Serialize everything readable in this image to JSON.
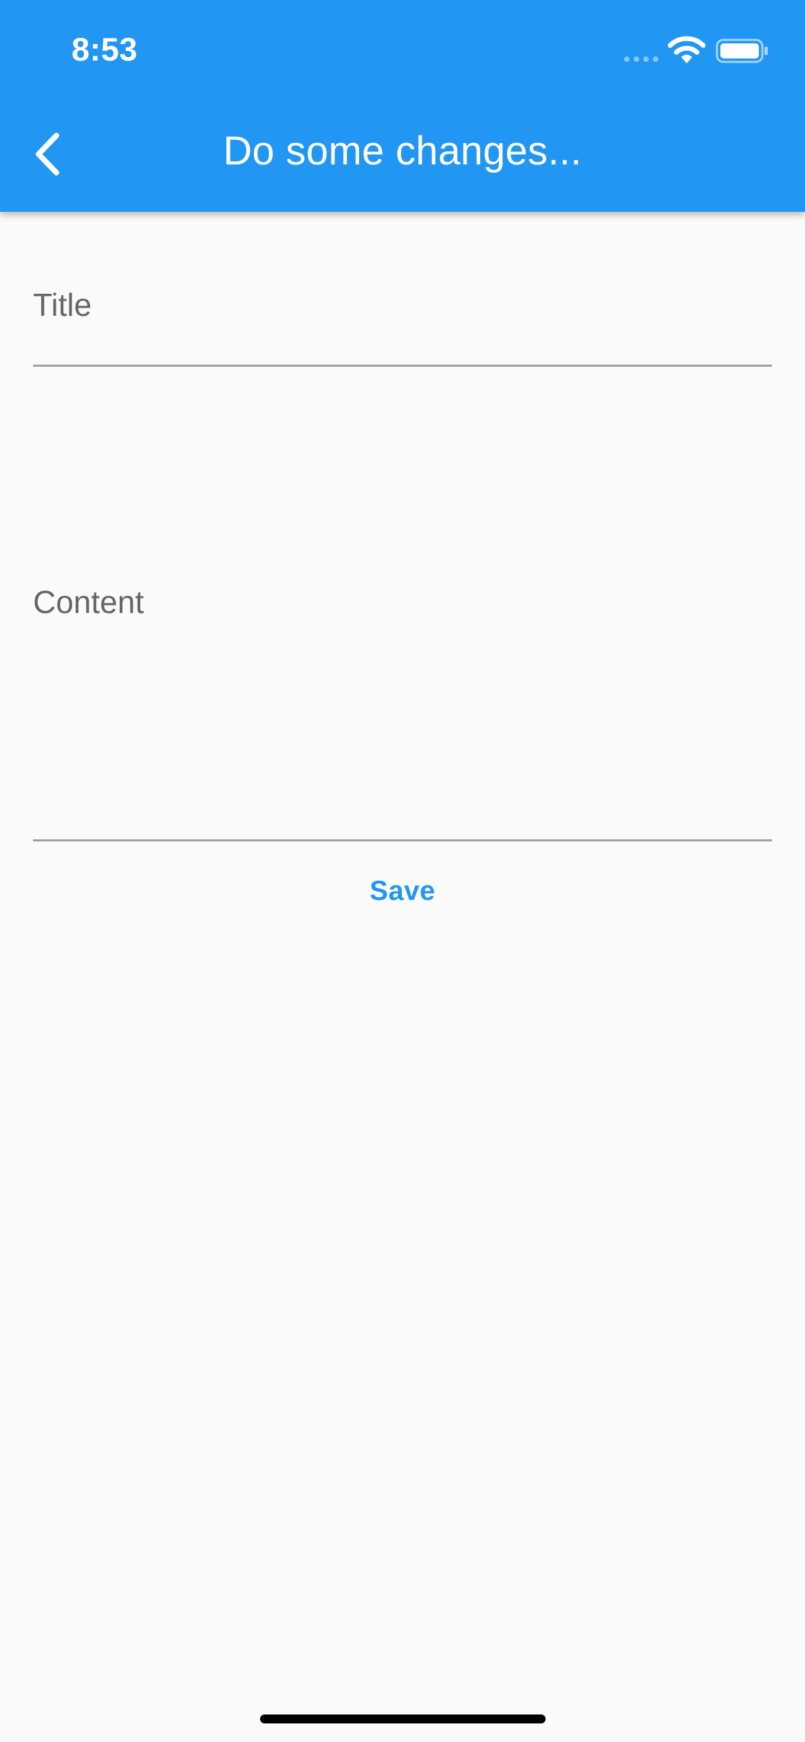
{
  "status_bar": {
    "time": "8:53"
  },
  "app_bar": {
    "title": "Do some changes...",
    "back_icon": "chevron-left-icon",
    "color": "#2196f3"
  },
  "form": {
    "title_field": {
      "label": "Title",
      "value": ""
    },
    "content_field": {
      "label": "Content",
      "value": ""
    },
    "save_label": "Save"
  },
  "colors": {
    "accent": "#2196f3",
    "background": "#fafafa",
    "label": "#666666",
    "underline": "#9e9e9e"
  }
}
